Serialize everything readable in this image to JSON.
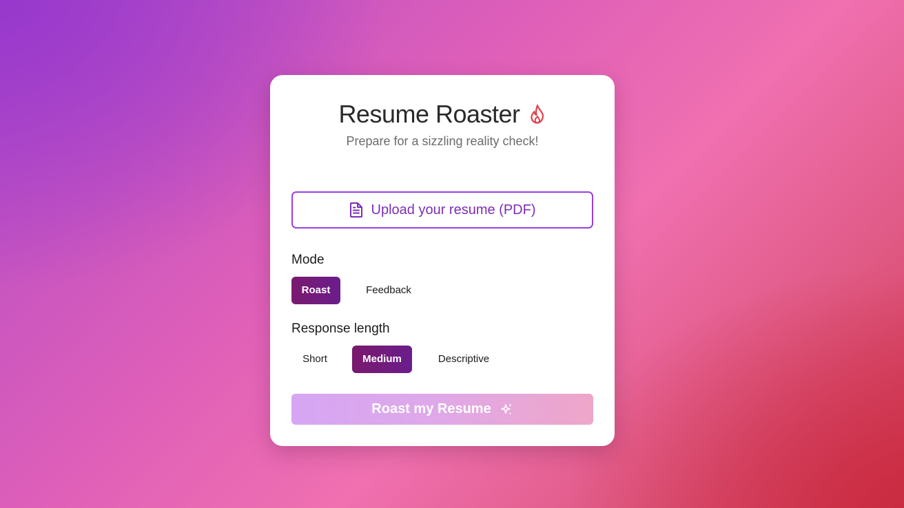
{
  "app": {
    "title": "Resume Roaster",
    "subtitle": "Prepare for a sizzling reality check!",
    "title_icon": "flame-icon"
  },
  "upload": {
    "label": "Upload your resume (PDF)",
    "icon": "document-icon",
    "accent_color": "#9a3fe0"
  },
  "mode": {
    "label": "Mode",
    "options": [
      "Roast",
      "Feedback"
    ],
    "selected": "Roast"
  },
  "length": {
    "label": "Response length",
    "options": [
      "Short",
      "Medium",
      "Descriptive"
    ],
    "selected": "Medium"
  },
  "submit": {
    "label": "Roast my Resume",
    "icon": "sparkles-icon",
    "state": "disabled"
  },
  "colors": {
    "active_option": "#74197c",
    "flame": "#e0404a",
    "upload_text": "#7c2db8"
  }
}
